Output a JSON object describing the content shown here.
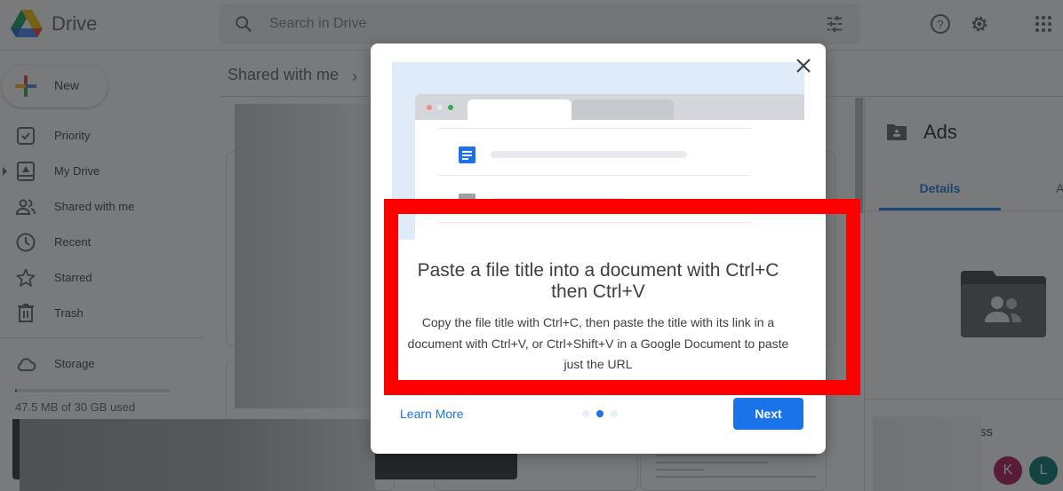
{
  "app": {
    "brand": "Drive",
    "search_placeholder": "Search in Drive"
  },
  "sidebar": {
    "new_label": "New",
    "items": [
      {
        "label": "Priority",
        "icon": "priority-icon"
      },
      {
        "label": "My Drive",
        "icon": "my-drive-icon"
      },
      {
        "label": "Shared with me",
        "icon": "shared-icon"
      },
      {
        "label": "Recent",
        "icon": "clock-icon"
      },
      {
        "label": "Starred",
        "icon": "star-icon"
      },
      {
        "label": "Trash",
        "icon": "trash-icon"
      }
    ],
    "storage_label": "Storage",
    "storage_used": "47.5 MB of 30 GB used",
    "storage_fraction": 0.0016
  },
  "main": {
    "breadcrumb": "Shared with me",
    "breadcrumb_chevron": "›"
  },
  "details_panel": {
    "title": "Ads",
    "tabs": [
      "Details",
      "A"
    ],
    "access_label": "ss",
    "avatars": [
      {
        "letter": "K",
        "color": "#ad1457"
      },
      {
        "letter": "L",
        "color": "#00796b"
      }
    ]
  },
  "dialog": {
    "title": "Paste a file title into a document with Ctrl+C then Ctrl+V",
    "body": "Copy the file title with Ctrl+C, then paste the title with its link in a document with Ctrl+V, or Ctrl+Shift+V in a Google Document to paste just the URL",
    "learn_more": "Learn More",
    "next": "Next",
    "page_current": 2,
    "page_total": 3
  },
  "colors": {
    "accent": "#1a73e8",
    "highlight": "#ff0000"
  }
}
